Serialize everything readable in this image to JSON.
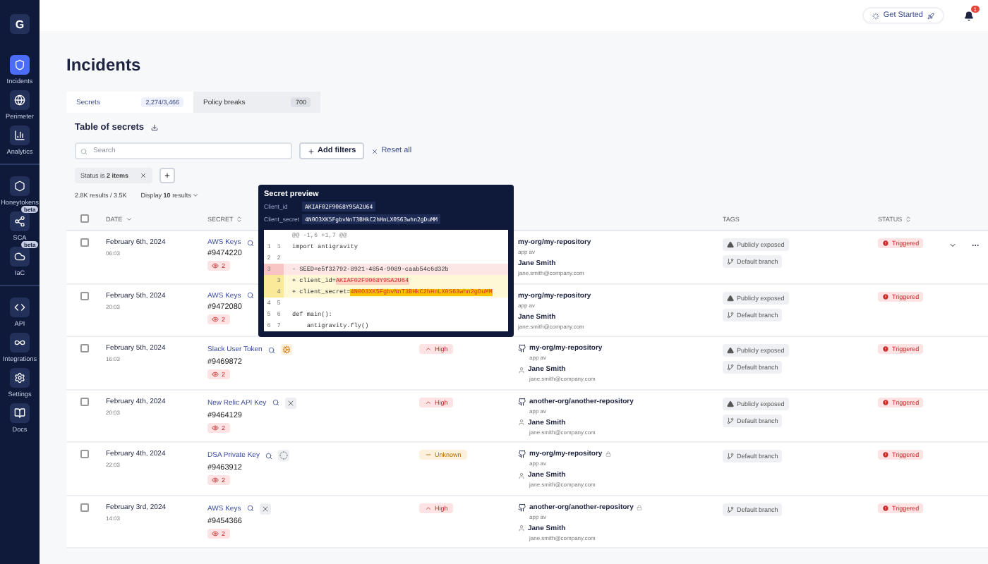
{
  "sidebar": {
    "logo": "G",
    "groups": [
      [
        {
          "label": "Incidents",
          "selected": true
        },
        {
          "label": "Perimeter",
          "selected": false
        },
        {
          "label": "Analytics",
          "selected": false
        }
      ],
      [
        {
          "label": "Honeytokens",
          "selected": false
        },
        {
          "label": "SCA",
          "selected": false,
          "badge": "beta"
        },
        {
          "label": "IaC",
          "selected": false,
          "badge": "beta"
        }
      ],
      [
        {
          "label": "API",
          "selected": false
        },
        {
          "label": "Integrations",
          "selected": false
        },
        {
          "label": "Settings",
          "selected": false
        },
        {
          "label": "Docs",
          "selected": false
        }
      ]
    ]
  },
  "topbar": {
    "get_started": "Get Started",
    "notifications": "1"
  },
  "page_title": "Incidents",
  "tabs": [
    {
      "label": "Secrets",
      "count": "2,274/3,466",
      "selected": true
    },
    {
      "label": "Policy breaks",
      "count": "700",
      "selected": false
    }
  ],
  "table_title": "Table of secrets",
  "search": {
    "placeholder": "Search"
  },
  "add_filters": "Add filters",
  "reset": "Reset all",
  "filter_chip": "Status is **2 items**",
  "results": "2.8K results / 3.5K",
  "display": "Display **10** results",
  "select_all": {
    "checked": false
  },
  "columns": [
    {
      "label": "DATE",
      "kind": "sorted"
    },
    {
      "label": "SECRET",
      "kind": "sortable"
    },
    {
      "label": "TAGS",
      "kind": "plain"
    },
    {
      "label": "STATUS",
      "kind": "sortable"
    }
  ],
  "rows": [
    {
      "checked": false,
      "date": "February 6th, 2024",
      "time": "06:03",
      "secret": "AWS Keys",
      "id": "#9474220",
      "occurrences": "2",
      "repo": "my-org/my-repository",
      "repo_icon": false,
      "private": false,
      "env": "app av",
      "user": "Jane Smith",
      "email": "jane.smith@company.com",
      "tags": [
        {
          "kind": "exposed",
          "label": "Publicly exposed"
        },
        {
          "kind": "branch",
          "label": "Default branch"
        }
      ],
      "status": "Triggered",
      "actions": true
    },
    {
      "checked": false,
      "date": "February 5th, 2024",
      "time": "20:03",
      "secret": "AWS Keys",
      "id": "#9472080",
      "occurrences": "2",
      "repo": "my-org/my-repository",
      "repo_icon": false,
      "private": false,
      "env": "app av",
      "user": "Jane Smith",
      "email": "jane.smith@company.com",
      "tags": [
        {
          "kind": "exposed",
          "label": "Publicly exposed"
        },
        {
          "kind": "branch",
          "label": "Default branch"
        }
      ],
      "status": "Triggered",
      "actions": false
    },
    {
      "checked": false,
      "date": "February 5th, 2024",
      "time": "16:03",
      "secret": "Slack User Token",
      "id": "#9469872",
      "validity": {
        "kind": "warning"
      },
      "occurrences": "2",
      "severity": {
        "kind": "high",
        "label": "High"
      },
      "repo": "my-org/my-repository",
      "repo_icon": true,
      "private": false,
      "env": "app av",
      "user": "Jane Smith",
      "email": "jane.smith@company.com",
      "tags": [
        {
          "kind": "exposed",
          "label": "Publicly exposed"
        },
        {
          "kind": "branch",
          "label": "Default branch"
        }
      ],
      "status": "Triggered",
      "actions": false
    },
    {
      "checked": false,
      "date": "February 4th, 2024",
      "time": "20:03",
      "secret": "New Relic API Key",
      "id": "#9464129",
      "validity": {
        "kind": "invalid"
      },
      "occurrences": "2",
      "severity": {
        "kind": "high",
        "label": "High"
      },
      "repo": "another-org/another-repository",
      "repo_icon": true,
      "private": false,
      "env": "app av",
      "user": "Jane Smith",
      "email": "jane.smith@company.com",
      "tags": [
        {
          "kind": "exposed",
          "label": "Publicly exposed"
        },
        {
          "kind": "branch",
          "label": "Default branch"
        }
      ],
      "status": "Triggered",
      "actions": false
    },
    {
      "checked": false,
      "date": "February 4th, 2024",
      "time": "22:03",
      "secret": "DSA Private Key",
      "id": "#9463912",
      "validity": {
        "kind": "unknown"
      },
      "occurrences": "2",
      "severity": {
        "kind": "unknown",
        "label": "Unknown"
      },
      "repo": "my-org/my-repository",
      "repo_icon": true,
      "private": true,
      "env": "app av",
      "user": "Jane Smith",
      "email": "jane.smith@company.com",
      "tags": [
        {
          "kind": "branch",
          "label": "Default branch"
        }
      ],
      "status": "Triggered",
      "actions": false
    },
    {
      "checked": false,
      "date": "February 3rd, 2024",
      "time": "14:03",
      "secret": "AWS Keys",
      "id": "#9454366",
      "validity": {
        "kind": "invalid"
      },
      "occurrences": "2",
      "severity": {
        "kind": "high",
        "label": "High"
      },
      "repo": "another-org/another-repository",
      "repo_icon": true,
      "private": true,
      "env": "app av",
      "user": "Jane Smith",
      "email": "jane.smith@company.com",
      "tags": [
        {
          "kind": "branch",
          "label": "Default branch"
        }
      ],
      "status": "Triggered",
      "actions": false
    }
  ],
  "preview": {
    "title": "Secret preview",
    "fields": [
      {
        "label": "Client_id",
        "value": "AKIAF02F9068Y9SA2U64"
      },
      {
        "label": "Client_secret",
        "value": "4N0O3XK5FgbvNnT3BHkC2hHnLX0S63whn2gDuMM"
      }
    ],
    "hunk": "@@ -1,6 +1,7 @@",
    "lines": [
      {
        "kind": "context",
        "old": "1",
        "new": "1",
        "code": "import antigravity"
      },
      {
        "kind": "context",
        "old": "2",
        "new": "2"
      },
      {
        "kind": "removed",
        "old": "3",
        "code": "- SEED=e5f32792-8921-4854-9089-caab54c6d32b"
      },
      {
        "kind": "added",
        "new": "3",
        "code": "+ client_id=",
        "secret": "AKIAF02F9068Y9SA2U64",
        "strong": false
      },
      {
        "kind": "added",
        "new": "4",
        "code": "+ client_secret=",
        "secret": "4N0O3XK5FgbvNnT3BHkC2hHnLX0S63whn2gDuMM",
        "strong": true
      },
      {
        "kind": "context",
        "old": "4",
        "new": "5"
      },
      {
        "kind": "context",
        "old": "5",
        "new": "6",
        "code": "def main():"
      },
      {
        "kind": "context",
        "old": "6",
        "new": "7",
        "code": "    antigravity.fly()"
      }
    ]
  }
}
